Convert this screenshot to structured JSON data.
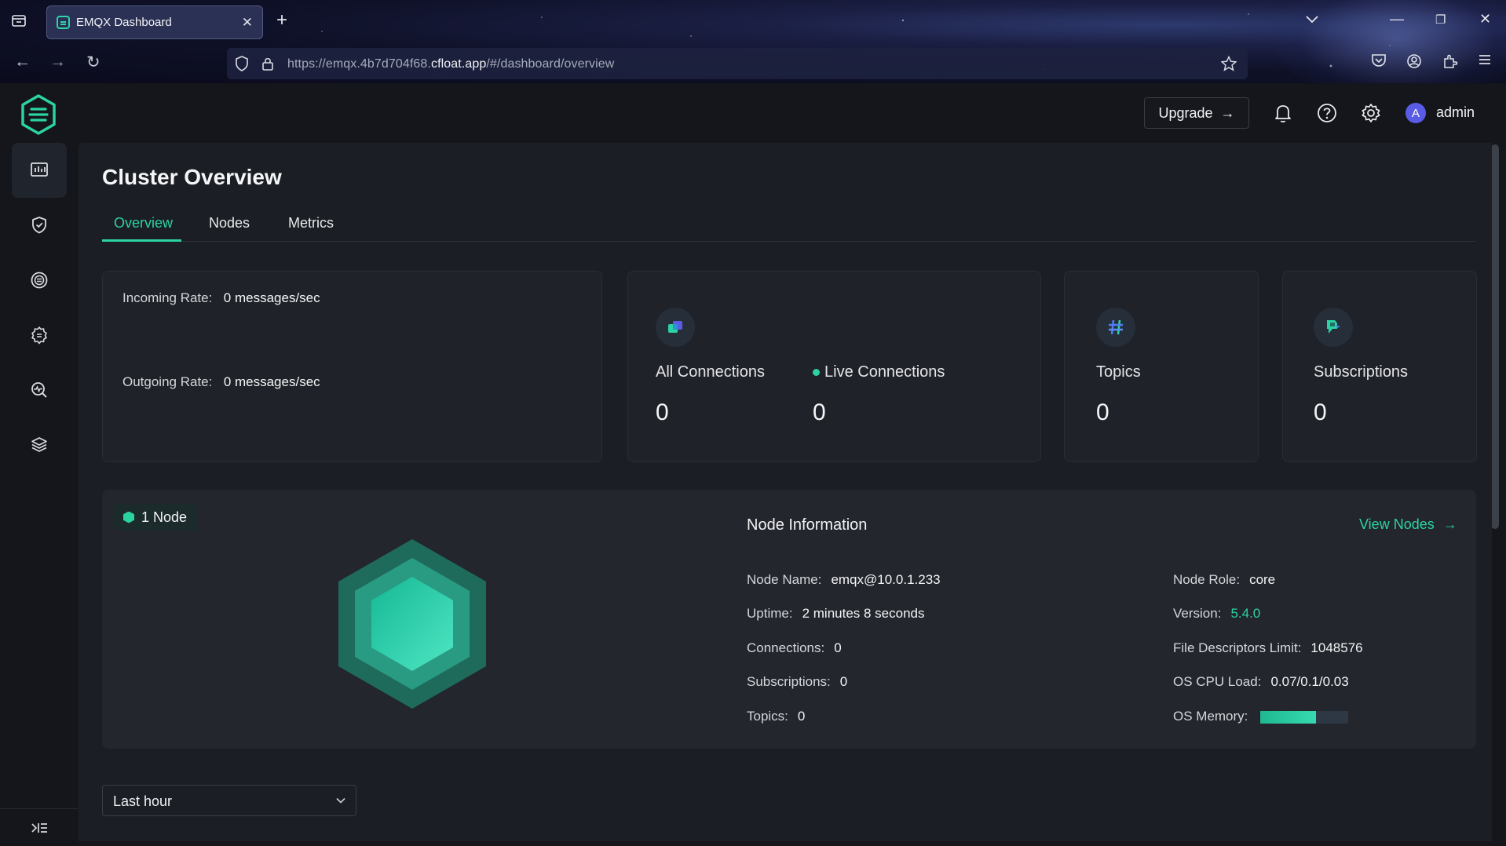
{
  "browser": {
    "tab_title": "EMQX Dashboard",
    "url_prefix": "https://emqx.4b7d704f68.",
    "url_domain": "cfloat.app",
    "url_suffix": "/#/dashboard/overview"
  },
  "header": {
    "upgrade_label": "Upgrade",
    "avatar_letter": "A",
    "username": "admin"
  },
  "sidebar": {
    "items": [
      {
        "icon": "dashboard-icon",
        "active": true
      },
      {
        "icon": "shield-icon",
        "active": false
      },
      {
        "icon": "integration-icon",
        "active": false
      },
      {
        "icon": "gear-management-icon",
        "active": false
      },
      {
        "icon": "diagnose-icon",
        "active": false
      },
      {
        "icon": "layers-icon",
        "active": false
      }
    ],
    "collapse_icon": "collapse-sidebar-icon"
  },
  "page": {
    "title": "Cluster Overview",
    "tabs": [
      "Overview",
      "Nodes",
      "Metrics"
    ],
    "active_tab": "Overview"
  },
  "rates": {
    "incoming_label": "Incoming Rate:",
    "incoming_value": "0 messages/sec",
    "outgoing_label": "Outgoing Rate:",
    "outgoing_value": "0 messages/sec"
  },
  "stats": {
    "all_connections_label": "All Connections",
    "all_connections_value": "0",
    "live_connections_label": "Live Connections",
    "live_connections_value": "0",
    "topics_label": "Topics",
    "topics_value": "0",
    "subscriptions_label": "Subscriptions",
    "subscriptions_value": "0"
  },
  "node": {
    "badge": "1 Node",
    "info_title": "Node Information",
    "view_nodes": "View Nodes",
    "left": [
      {
        "label": "Node Name:",
        "value": "emqx@10.0.1.233"
      },
      {
        "label": "Uptime:",
        "value": "2 minutes 8 seconds"
      },
      {
        "label": "Connections:",
        "value": "0"
      },
      {
        "label": "Subscriptions:",
        "value": "0"
      },
      {
        "label": "Topics:",
        "value": "0"
      }
    ],
    "right": [
      {
        "label": "Node Role:",
        "value": "core"
      },
      {
        "label": "Version:",
        "value": "5.4.0"
      },
      {
        "label": "File Descriptors Limit:",
        "value": "1048576"
      },
      {
        "label": "OS CPU Load:",
        "value": "0.07/0.1/0.03"
      },
      {
        "label": "OS Memory:",
        "value": ""
      }
    ],
    "os_memory_fraction": 0.63
  },
  "time_range": {
    "selected": "Last hour"
  },
  "colors": {
    "accent": "#2bd3a3",
    "background": "#14161b",
    "panel": "#1b1e24",
    "card": "#1f2228"
  }
}
